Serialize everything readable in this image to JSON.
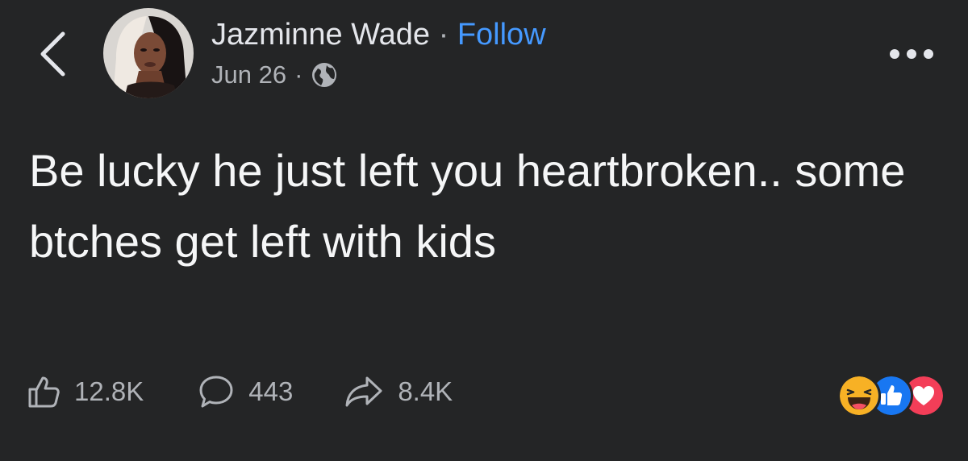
{
  "header": {
    "author_name": "Jazminne Wade",
    "separator": "·",
    "follow_label": "Follow",
    "date": "Jun 26",
    "meta_separator": "·",
    "privacy_icon": "globe-icon",
    "back_icon": "chevron-left-icon",
    "more_icon": "more-options-icon"
  },
  "post": {
    "text": "Be lucky he just left you heartbroken.. some btches get left with kids"
  },
  "actions": {
    "like_count": "12.8K",
    "comment_count": "443",
    "share_count": "8.4K"
  },
  "reactions": [
    "haha-reaction-icon",
    "like-reaction-icon",
    "love-reaction-icon"
  ],
  "colors": {
    "background": "#242526",
    "primary_text": "#e4e6eb",
    "secondary_text": "#b0b3b8",
    "link": "#4599ff",
    "like_blue": "#1877f2",
    "love_red": "#f33e58",
    "haha_yellow": "#f7b125"
  }
}
